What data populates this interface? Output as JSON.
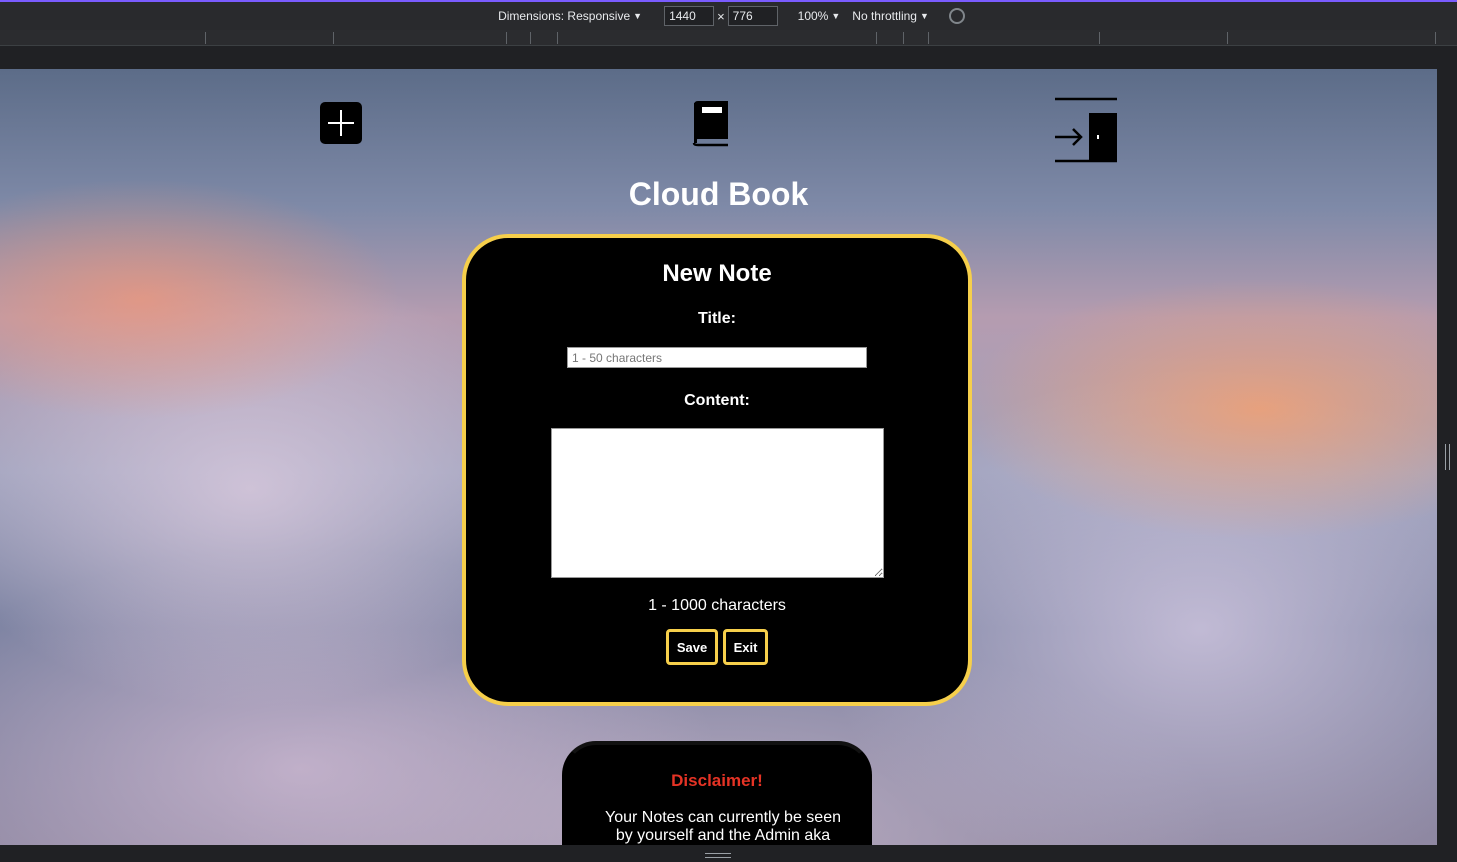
{
  "devtools": {
    "dimensions_label": "Dimensions: Responsive",
    "width_value": "1440",
    "height_value": "776",
    "times": "×",
    "zoom_label": "100%",
    "throttling_label": "No throttling"
  },
  "nav": {
    "add_icon": "plus-icon",
    "book_icon": "book-icon",
    "logout_icon": "logout-door-icon"
  },
  "app": {
    "title": "Cloud Book"
  },
  "note_form": {
    "heading": "New Note",
    "title_label": "Title:",
    "title_placeholder": "1 - 50 characters",
    "content_label": "Content:",
    "content_hint": "1 - 1000 characters",
    "save_label": "Save",
    "exit_label": "Exit"
  },
  "disclaimer": {
    "title": "Disclaimer!",
    "text": "Your Notes can currently be seen by yourself and the Admin aka"
  },
  "colors": {
    "accent_border": "#f6cf4b",
    "disclaimer_title": "#e53325",
    "card_background": "#000000"
  }
}
